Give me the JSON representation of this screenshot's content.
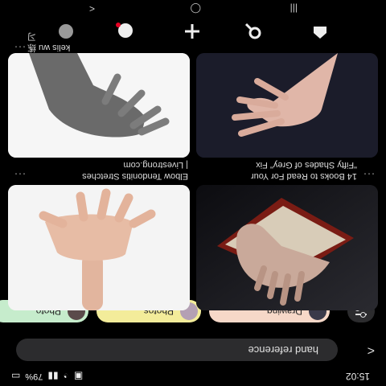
{
  "status": {
    "time": "15:02",
    "battery": "79%"
  },
  "search": {
    "query": "hand reference"
  },
  "chips": [
    {
      "label": "Drawing",
      "bg": "#f6d8c8"
    },
    {
      "label": "Photos",
      "bg": "#f3ec9a"
    },
    {
      "label": "Photo",
      "bg": "#c6eccc"
    }
  ],
  "results": [
    {
      "caption_lines": [
        "14 Books to Read For Your",
        "\"Fifty Shades of Grey\" Fix"
      ]
    },
    {
      "caption_lines": [
        "Elbow Tendonitis Stretches",
        "| Livestrong.com"
      ]
    },
    {
      "caption_lines": []
    },
    {
      "caption_lines": []
    }
  ],
  "pins": [
    {
      "user": "kelis wu",
      "tag": "练习"
    }
  ],
  "nav": [
    "home",
    "search",
    "create",
    "notifications",
    "profile"
  ],
  "colors": {
    "background": "#000000",
    "search_bg": "#2c2c2e"
  }
}
